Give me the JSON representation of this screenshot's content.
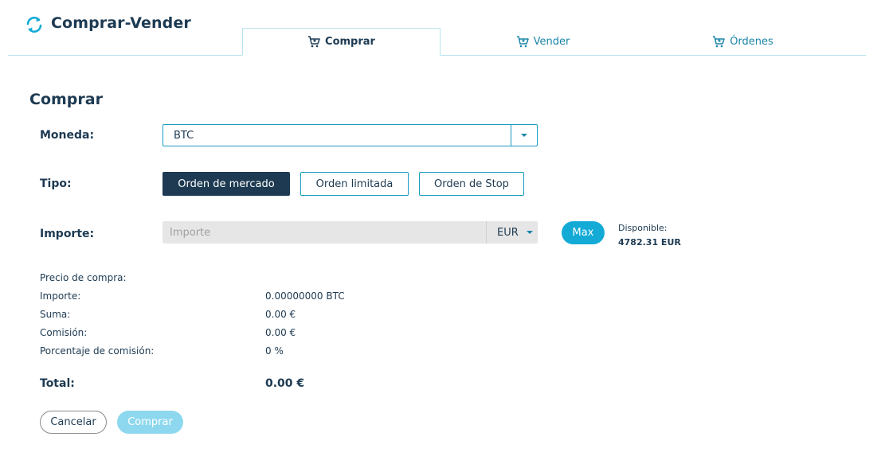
{
  "app": {
    "title": "Comprar-Vender"
  },
  "tabs": [
    {
      "label": "Comprar",
      "icon": "cart-icon",
      "active": true
    },
    {
      "label": "Vender",
      "icon": "cart-icon",
      "active": false
    },
    {
      "label": "Órdenes",
      "icon": "cart-icon",
      "active": false
    }
  ],
  "form": {
    "title": "Comprar",
    "currency_label": "Moneda:",
    "currency_value": "BTC",
    "type_label": "Tipo:",
    "types": [
      {
        "label": "Orden de mercado",
        "active": true
      },
      {
        "label": "Orden limitada",
        "active": false
      },
      {
        "label": "Orden de Stop",
        "active": false
      }
    ],
    "amount_label": "Importe:",
    "amount_placeholder": "Importe",
    "amount_value": "",
    "amount_currency": "EUR",
    "max_label": "Max",
    "available_label": "Disponible:",
    "available_value": "4782.31 EUR"
  },
  "summary": {
    "price_label": "Precio de compra:",
    "price_value": "",
    "amount_label": "Importe:",
    "amount_value": "0.00000000 BTC",
    "sum_label": "Suma:",
    "sum_value": "0.00 €",
    "fee_label": "Comisión:",
    "fee_value": "0.00 €",
    "fee_pct_label": "Porcentaje de comisión:",
    "fee_pct_value": "0 %",
    "total_label": "Total:",
    "total_value": "0.00 €"
  },
  "actions": {
    "cancel_label": "Cancelar",
    "buy_label": "Comprar"
  },
  "colors": {
    "primary": "#1d3a52",
    "accent": "#13aad6",
    "accent_light": "#8dd8ee",
    "border": "#1a9bc1"
  }
}
